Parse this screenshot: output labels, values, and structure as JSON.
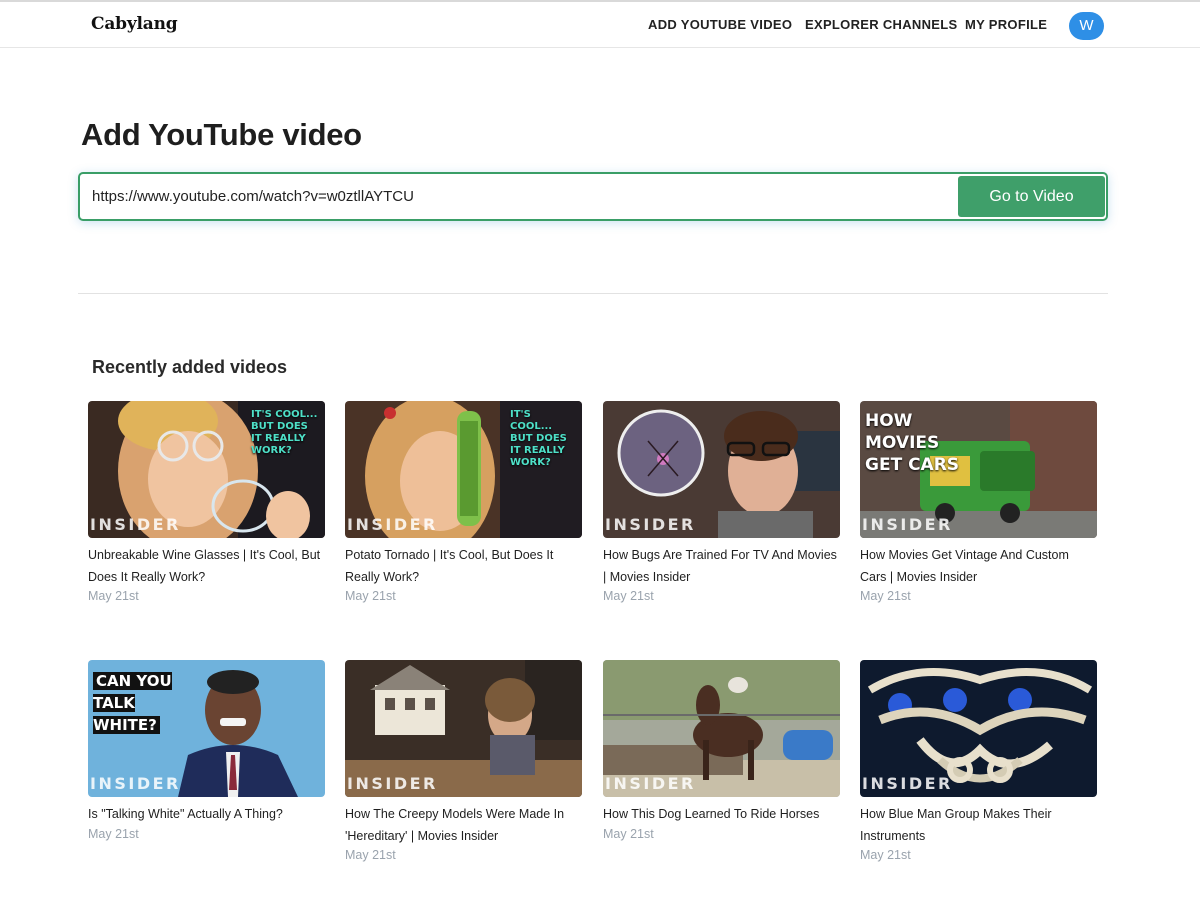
{
  "app": {
    "brand": "Cabylang"
  },
  "nav": {
    "links": [
      "ADD YOUTUBE VIDEO",
      "EXPLORER CHANNELS",
      "MY PROFILE"
    ],
    "avatar_initial": "W"
  },
  "main": {
    "title": "Add YouTube video",
    "url_value": "https://www.youtube.com/watch?v=w0ztllAYTCU",
    "go_button": "Go to Video",
    "section_title": "Recently added videos"
  },
  "videos": [
    {
      "title": "Unbreakable Wine Glasses | It's Cool, But Does It Really Work?",
      "date": "May 21st",
      "brand": "INSIDER",
      "overlay": "IT'S COOL... BUT DOES IT REALLY WORK?"
    },
    {
      "title": "Potato Tornado | It's Cool, But Does It Really Work?",
      "date": "May 21st",
      "brand": "INSIDER",
      "overlay": "IT'S COOL... BUT DOES IT REALLY WORK?"
    },
    {
      "title": "How Bugs Are Trained For TV And Movies | Movies Insider",
      "date": "May 21st",
      "brand": "INSIDER",
      "overlay": ""
    },
    {
      "title": "How Movies Get Vintage And Custom Cars | Movies Insider",
      "date": "May 21st",
      "brand": "INSIDER",
      "overlay": "HOW MOVIES GET CARS"
    },
    {
      "title": "Is \"Talking White\" Actually A Thing?",
      "date": "May 21st",
      "brand": "INSIDER",
      "overlay": "CAN YOU TALK WHITE?"
    },
    {
      "title": "How The Creepy Models Were Made In 'Hereditary' | Movies Insider",
      "date": "May 21st",
      "brand": "INSIDER",
      "overlay": ""
    },
    {
      "title": "How This Dog Learned To Ride Horses",
      "date": "May 21st",
      "brand": "INSIDER",
      "overlay": ""
    },
    {
      "title": "How Blue Man Group Makes Their Instruments",
      "date": "May 21st",
      "brand": "INSIDER",
      "overlay": ""
    }
  ],
  "colors": {
    "accent_green": "#3f9f6a",
    "avatar_blue": "#2e8fe6",
    "date_gray": "#9aa3ad"
  }
}
